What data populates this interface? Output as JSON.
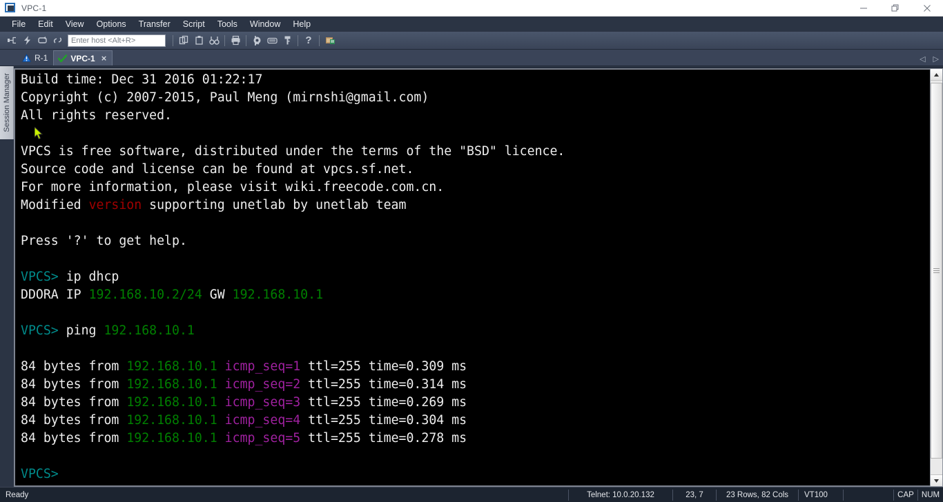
{
  "window": {
    "title": "VPC-1",
    "app_icon": "terminal-window-icon",
    "minimize_label": "—",
    "restore_label": "❐",
    "close_label": "✕"
  },
  "menubar": {
    "items": [
      {
        "label": "File"
      },
      {
        "label": "Edit"
      },
      {
        "label": "View"
      },
      {
        "label": "Options"
      },
      {
        "label": "Transfer"
      },
      {
        "label": "Script"
      },
      {
        "label": "Tools"
      },
      {
        "label": "Window"
      },
      {
        "label": "Help"
      }
    ]
  },
  "toolbar": {
    "host_placeholder": "Enter host <Alt+R>",
    "host_value": "",
    "buttons": [
      {
        "name": "connect-icon",
        "glyph": "⊸"
      },
      {
        "name": "quick-connect-icon",
        "glyph": "⚡"
      },
      {
        "name": "reconnect-icon",
        "glyph": "↻"
      },
      {
        "name": "disconnect-icon",
        "glyph": "⚭"
      },
      {
        "name": "copy-icon",
        "glyph": "❐"
      },
      {
        "name": "paste-icon",
        "glyph": "Ὄb"
      },
      {
        "name": "find-icon",
        "glyph": "⌗"
      },
      {
        "name": "print-icon",
        "glyph": "⎙"
      },
      {
        "name": "settings-gear-icon",
        "glyph": "⚙"
      },
      {
        "name": "keyboard-icon",
        "glyph": "⌨"
      },
      {
        "name": "key-icon",
        "glyph": "⚿"
      },
      {
        "name": "help-icon",
        "glyph": "?"
      },
      {
        "name": "session-manager-icon",
        "glyph": "▤"
      }
    ]
  },
  "tabs": {
    "items": [
      {
        "label": "R-1",
        "status_icon": "warning-triangle-icon",
        "active": false,
        "closable": false
      },
      {
        "label": "VPC-1",
        "status_icon": "green-check-icon",
        "active": true,
        "closable": true
      }
    ],
    "close_glyph": "×",
    "nav_prev": "◁",
    "nav_next": "▷"
  },
  "sidebar": {
    "session_manager_label": "Session Manager"
  },
  "terminal": {
    "lines": [
      [
        {
          "t": "Build time: Dec 31 2016 01:22:17",
          "c": "white"
        }
      ],
      [
        {
          "t": "Copyright (c) 2007-2015, Paul Meng (mirnshi@gmail.com)",
          "c": "white"
        }
      ],
      [
        {
          "t": "All rights reserved.",
          "c": "white"
        }
      ],
      [
        {
          "t": "",
          "c": "white"
        }
      ],
      [
        {
          "t": "VPCS is free software, distributed under the terms of the \"BSD\" licence.",
          "c": "white"
        }
      ],
      [
        {
          "t": "Source code and license can be found at vpcs.sf.net.",
          "c": "white"
        }
      ],
      [
        {
          "t": "For more information, please visit wiki.freecode.com.cn.",
          "c": "white"
        }
      ],
      [
        {
          "t": "Modified ",
          "c": "white"
        },
        {
          "t": "version",
          "c": "red"
        },
        {
          "t": " supporting unetlab by unetlab team",
          "c": "white"
        }
      ],
      [
        {
          "t": "",
          "c": "white"
        }
      ],
      [
        {
          "t": "Press '?' to get help.",
          "c": "white"
        }
      ],
      [
        {
          "t": "",
          "c": "white"
        }
      ],
      [
        {
          "t": "VPCS>",
          "c": "teal"
        },
        {
          "t": " ip dhcp",
          "c": "white"
        }
      ],
      [
        {
          "t": "DDORA IP ",
          "c": "white"
        },
        {
          "t": "192.168.10.2/24",
          "c": "green"
        },
        {
          "t": " GW ",
          "c": "white"
        },
        {
          "t": "192.168.10.1",
          "c": "green"
        }
      ],
      [
        {
          "t": "",
          "c": "white"
        }
      ],
      [
        {
          "t": "VPCS>",
          "c": "teal"
        },
        {
          "t": " ping ",
          "c": "white"
        },
        {
          "t": "192.168.10.1",
          "c": "green"
        }
      ],
      [
        {
          "t": "",
          "c": "white"
        }
      ],
      [
        {
          "t": "84 bytes from ",
          "c": "white"
        },
        {
          "t": "192.168.10.1",
          "c": "green"
        },
        {
          "t": " ",
          "c": "white"
        },
        {
          "t": "icmp_seq=1",
          "c": "magenta"
        },
        {
          "t": " ttl=255 time=0.309 ms",
          "c": "white"
        }
      ],
      [
        {
          "t": "84 bytes from ",
          "c": "white"
        },
        {
          "t": "192.168.10.1",
          "c": "green"
        },
        {
          "t": " ",
          "c": "white"
        },
        {
          "t": "icmp_seq=2",
          "c": "magenta"
        },
        {
          "t": " ttl=255 time=0.314 ms",
          "c": "white"
        }
      ],
      [
        {
          "t": "84 bytes from ",
          "c": "white"
        },
        {
          "t": "192.168.10.1",
          "c": "green"
        },
        {
          "t": " ",
          "c": "white"
        },
        {
          "t": "icmp_seq=3",
          "c": "magenta"
        },
        {
          "t": " ttl=255 time=0.269 ms",
          "c": "white"
        }
      ],
      [
        {
          "t": "84 bytes from ",
          "c": "white"
        },
        {
          "t": "192.168.10.1",
          "c": "green"
        },
        {
          "t": " ",
          "c": "white"
        },
        {
          "t": "icmp_seq=4",
          "c": "magenta"
        },
        {
          "t": " ttl=255 time=0.304 ms",
          "c": "white"
        }
      ],
      [
        {
          "t": "84 bytes from ",
          "c": "white"
        },
        {
          "t": "192.168.10.1",
          "c": "green"
        },
        {
          "t": " ",
          "c": "white"
        },
        {
          "t": "icmp_seq=5",
          "c": "magenta"
        },
        {
          "t": " ttl=255 time=0.278 ms",
          "c": "white"
        }
      ],
      [
        {
          "t": "",
          "c": "white"
        }
      ],
      [
        {
          "t": "VPCS>",
          "c": "teal"
        }
      ]
    ]
  },
  "statusbar": {
    "ready": "Ready",
    "connection": "Telnet: 10.0.20.132",
    "cursor_pos": "23,  7",
    "dimensions": "23 Rows, 82 Cols",
    "emulation": "VT100",
    "blank": "",
    "cap": "CAP",
    "num": "NUM"
  },
  "colors": {
    "terminal_bg": "#000000",
    "terminal_fg": "#e9e9e9",
    "prompt_teal": "#008b8b",
    "ip_green": "#007f00",
    "icmp_magenta": "#a021a0",
    "version_red": "#a00000",
    "chrome_dark": "#2b3444",
    "tab_active": "#4d586e",
    "statusbar_bg": "#1c2430"
  }
}
